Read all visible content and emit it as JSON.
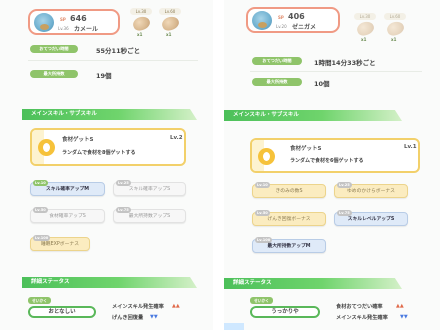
{
  "left": {
    "header": {
      "sp_tag": "SP",
      "sp_value": "646",
      "level": "Lv.36",
      "name": "カメール",
      "ingredients": [
        {
          "level": "Lv.30",
          "count": "x1"
        },
        {
          "level": "Lv.60",
          "count": "x1"
        }
      ]
    },
    "rows": [
      {
        "label": "おてつだい時間",
        "value": "55分11秒ごと"
      },
      {
        "label": "最大所持数",
        "value": "19個"
      }
    ],
    "section_skills": "メインスキル・サブスキル",
    "main_skill": {
      "name": "食材ゲットS",
      "level": "Lv.2",
      "description": "ランダムで食材を8個ゲットする"
    },
    "subskills": [
      {
        "level": "Lv.10",
        "label": "スキル確率アップM",
        "style": "blue"
      },
      {
        "level": "Lv.25",
        "label": "スキル確率アップS",
        "style": "grey"
      },
      {
        "level": "Lv.50",
        "label": "食材確率アップS",
        "style": "grey"
      },
      {
        "level": "Lv.75",
        "label": "最大所持数アップS",
        "style": "grey"
      },
      {
        "level": "Lv.100",
        "label": "睡眠EXPボーナス",
        "style": "gold"
      }
    ],
    "section_stats": "詳細ステータス",
    "nature_tag": "せいかく",
    "nature": "おとなしい",
    "stats": [
      "メインスキル発生確率",
      "げんき回復量"
    ]
  },
  "right": {
    "header": {
      "sp_tag": "SP",
      "sp_value": "406",
      "level": "Lv.20",
      "name": "ゼニガメ",
      "ingredients": [
        {
          "level": "Lv.30",
          "count": "x1"
        },
        {
          "level": "Lv.60",
          "count": "x1"
        }
      ]
    },
    "rows": [
      {
        "label": "おてつだい時間",
        "value": "1時間14分33秒ごと"
      },
      {
        "label": "最大所持数",
        "value": "10個"
      }
    ],
    "section_skills": "メインスキル・サブスキル",
    "main_skill": {
      "name": "食材ゲットS",
      "level": "Lv.1",
      "description": "ランダムで食材を6個ゲットする"
    },
    "subskills": [
      {
        "level": "Lv.10",
        "label": "きのみの数S",
        "style": "gold"
      },
      {
        "level": "Lv.25",
        "label": "ゆめのかけらボーナス",
        "style": "gold"
      },
      {
        "level": "Lv.50",
        "label": "げんき回復ボーナス",
        "style": "gold"
      },
      {
        "level": "Lv.75",
        "label": "スキルレベルアップS",
        "style": "blue"
      },
      {
        "level": "Lv.100",
        "label": "最大所持数アップM",
        "style": "blue"
      }
    ],
    "section_stats": "詳細ステータス",
    "nature_tag": "せいかく",
    "nature": "うっかりや",
    "stats": [
      "食材おてつだい確率",
      "メインスキル発生確率"
    ]
  },
  "colors": {
    "accent_green": "#4cc05a",
    "card_border": "#f09a84",
    "main_skill_border": "#f2d06a",
    "up": "#e06a4a",
    "down": "#4a7ae0"
  }
}
